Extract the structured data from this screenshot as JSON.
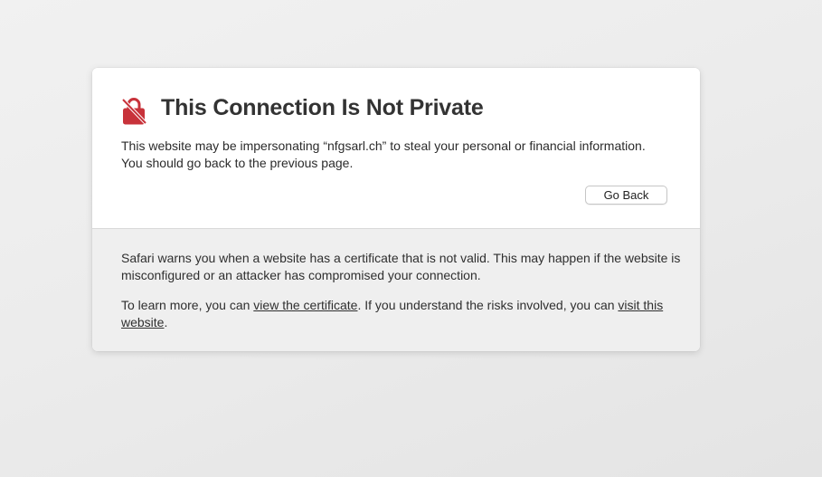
{
  "colors": {
    "background": "#ececec",
    "card_top": "#ffffff",
    "card_bottom": "#efefef",
    "lock_icon": "#c8323a",
    "title_text": "#333333"
  },
  "warning": {
    "icon": "broken-lock-icon",
    "title": "This Connection Is Not Private",
    "message_line1": "This website may be impersonating “nfgsarl.ch” to steal your personal or financial information.",
    "message_line2": "You should go back to the previous page.",
    "go_back_label": "Go Back"
  },
  "details": {
    "paragraph1": "Safari warns you when a website has a certificate that is not valid. This may happen if the website is misconfigured or an attacker has compromised your connection.",
    "learn_more_prefix": "To learn more, you can ",
    "view_certificate_link": "view the certificate",
    "learn_more_middle": ". If you understand the risks involved, you can ",
    "visit_website_link": "visit this website",
    "learn_more_suffix": "."
  }
}
